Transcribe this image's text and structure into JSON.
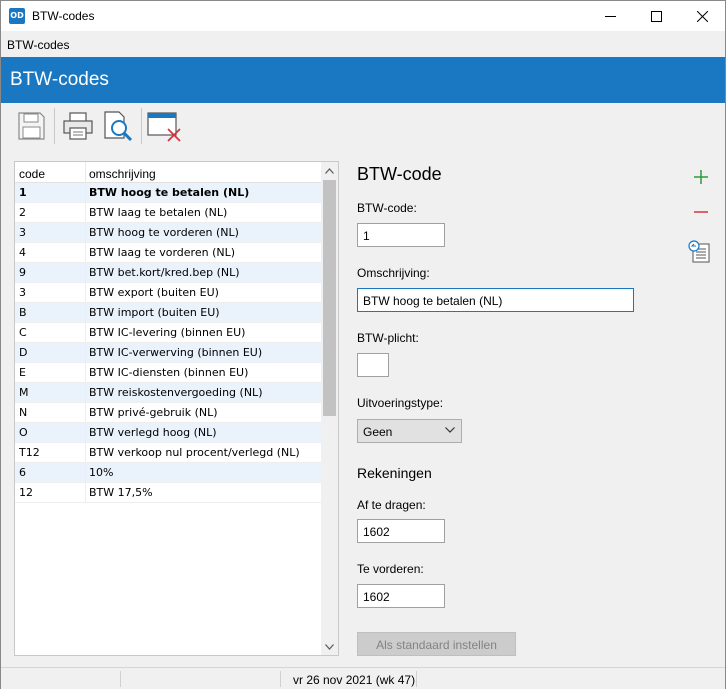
{
  "window": {
    "app_logo": "OD",
    "title": "BTW-codes",
    "controls": [
      "minimize-icon",
      "maximize-icon",
      "close-icon"
    ]
  },
  "menu": {
    "label": "BTW-codes"
  },
  "banner": {
    "title": "BTW-codes"
  },
  "toolbar": {
    "buttons": [
      "save-icon",
      "print-icon",
      "print-preview-icon",
      "close-window-icon"
    ]
  },
  "grid": {
    "columns": {
      "code": "code",
      "description": "omschrijving"
    },
    "selected_index": 0,
    "rows": [
      {
        "code": "1",
        "description": "BTW hoog te betalen (NL)"
      },
      {
        "code": "2",
        "description": "BTW laag te betalen (NL)"
      },
      {
        "code": "3",
        "description": "BTW hoog te vorderen (NL)"
      },
      {
        "code": "4",
        "description": "BTW laag te vorderen (NL)"
      },
      {
        "code": "9",
        "description": "BTW bet.kort/kred.bep (NL)"
      },
      {
        "code": "3",
        "description": "BTW export (buiten EU)"
      },
      {
        "code": "B",
        "description": "BTW import (buiten EU)"
      },
      {
        "code": "C",
        "description": "BTW IC-levering (binnen EU)"
      },
      {
        "code": "D",
        "description": "BTW IC-verwerving (binnen EU)"
      },
      {
        "code": "E",
        "description": "BTW IC-diensten (binnen EU)"
      },
      {
        "code": "M",
        "description": "BTW reiskostenvergoeding (NL)"
      },
      {
        "code": "N",
        "description": "BTW privé-gebruik (NL)"
      },
      {
        "code": "O",
        "description": "BTW verlegd hoog (NL)"
      },
      {
        "code": "T12",
        "description": "BTW verkoop nul procent/verlegd (NL)"
      },
      {
        "code": "6",
        "description": "10%"
      },
      {
        "code": "12",
        "description": "BTW 17,5%"
      }
    ]
  },
  "form": {
    "title": "BTW-code",
    "btw_code_label": "BTW-code:",
    "btw_code_value": "1",
    "omschrijving_label": "Omschrijving:",
    "omschrijving_value": "BTW hoog te betalen (NL)",
    "btw_plicht_label": "BTW-plicht:",
    "btw_plicht_value": "",
    "uitvoeringstype_label": "Uitvoeringstype:",
    "uitvoeringstype_value": "Geen",
    "rekeningen_title": "Rekeningen",
    "af_te_dragen_label": "Af te dragen:",
    "af_te_dragen_value": "1602",
    "te_vorderen_label": "Te vorderen:",
    "te_vorderen_value": "1602",
    "standaard_button": "Als standaard instellen"
  },
  "side_actions": {
    "add": "plus-icon",
    "remove": "minus-icon",
    "details": "details-icon"
  },
  "colors": {
    "accent": "#1a78c2",
    "add": "#2e9b3a",
    "remove": "#d9333f",
    "row_alt": "#eaf2fb"
  },
  "status": {
    "date": "vr 26 nov 2021 (wk 47)"
  }
}
